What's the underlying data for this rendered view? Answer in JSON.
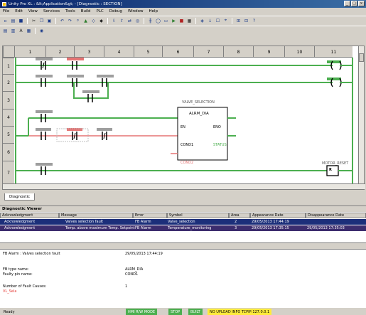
{
  "window": {
    "title": "Unity Pro XL : &lt;Application&gt; - [Diagnostic : SECTION]",
    "min": "_",
    "max": "□",
    "close": "×"
  },
  "menu": [
    "File",
    "Edit",
    "View",
    "Services",
    "Tools",
    "Build",
    "PLC",
    "Debug",
    "Window",
    "Help"
  ],
  "editor": {
    "columns": [
      "1",
      "2",
      "3",
      "4",
      "5",
      "6",
      "7",
      "8",
      "9",
      "10",
      "11"
    ],
    "rows": [
      "1",
      "2",
      "3",
      "4",
      "5",
      "6",
      "7"
    ],
    "block": {
      "instance": "VALVE_SELECTION",
      "type": "ALRM_DIA",
      "pin_en": "EN",
      "pin_eno": "ENO",
      "pin_cond1": "COND1",
      "pin_status": "STATUS",
      "pin_cond2": "COND2"
    },
    "coil_label": "R",
    "coil_out": "MOTOR_RESET",
    "coil_top": "( )",
    "tab": "Diagnostic"
  },
  "diagnostic": {
    "title": "Diagnostic Viewer",
    "headers": [
      "Acknowledgment",
      "Message",
      "Error",
      "Symbol",
      "Area",
      "Appearance Date",
      "Disappearance Date"
    ],
    "rows": [
      [
        "Acknowledgment",
        "Valves selection fault",
        "FB Alarm",
        "Valve_selection",
        "2",
        "29/05/2013 17:44:19",
        ""
      ],
      [
        "Acknowledgment",
        "Temp. above maximum Temp. Setpoint",
        "FB Alarm",
        "Temperature_monitoring",
        "3",
        "29/05/2013 17:35:15",
        "29/05/2013 17:35:03"
      ]
    ],
    "details": {
      "row1_label": "FB Alarm : Valves selection fault",
      "row1_value": "29/05/2013 17:44:19",
      "type_label": "FB type name:",
      "type_value": "ALRM_DIA",
      "var_label": "Faulty pin name:",
      "var_value": "COND1",
      "count_label": "Number of Fault Causes:",
      "count_value": "1",
      "cause": "VL_Sela"
    }
  },
  "status": {
    "ready": "Ready",
    "s1": "HMI R/W MODE",
    "s2": "STOP",
    "s3": "BUILT",
    "s4": "NO UPLOAD INFO  TCPIP:127.0.0.1"
  }
}
